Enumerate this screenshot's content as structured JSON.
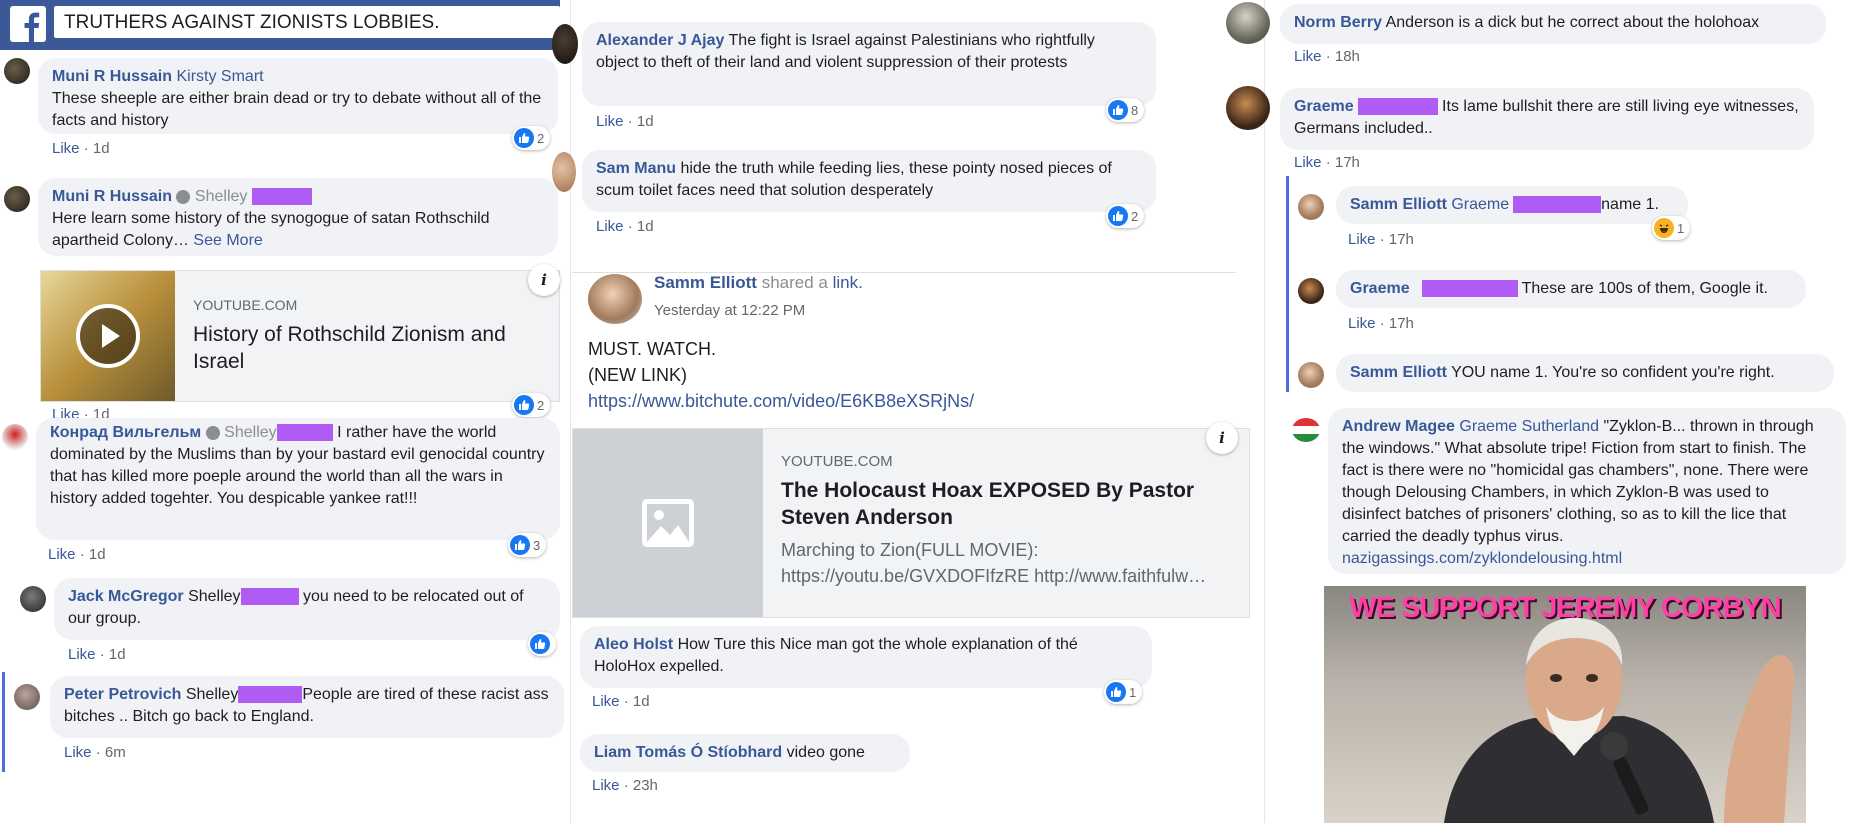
{
  "header": {
    "search_value": "TRUTHERS AGAINST ZIONISTS LOBBIES."
  },
  "colors": {
    "facebook_blue": "#3b5998",
    "link": "#385898",
    "redaction": "#b15bf5",
    "bubble": "#f0f2f5"
  },
  "left": {
    "c1": {
      "name": "Muni R Hussain",
      "mention": "Kirsty Smart",
      "text": "These sheeple are either brain dead or try to debate without all of the facts and history",
      "like": "Like",
      "time": "1d",
      "reactions": "2"
    },
    "c2": {
      "name": "Muni R Hussain",
      "mention": "Shelley",
      "text": "Here learn some history of the synogogue of satan Rothschild apartheid Colony…",
      "see_more": "See More",
      "card": {
        "source": "YOUTUBE.COM",
        "title": "History of Rothschild Zionism and Israel"
      },
      "like": "Like",
      "time": "1d",
      "reactions": "2"
    },
    "c3": {
      "name": "Конрад Вильгельм",
      "mention": "Shelley",
      "text": "I rather have the world dominated by the Muslims than by your bastard evil genocidal country that has killed more poeple around the world than all the wars in history added togehter. You despicable yankee rat!!!",
      "like": "Like",
      "time": "1d",
      "reactions": "3"
    },
    "c4": {
      "name": "Jack McGregor",
      "mention": "Shelley",
      "text": "you need to be relocated out of our group.",
      "like": "Like",
      "time": "1d"
    },
    "c5": {
      "name": "Peter Petrovich",
      "mention": "Shelley",
      "text": "People are tired of these racist ass bitches .. Bitch go back to England.",
      "like": "Like",
      "time": "6m"
    }
  },
  "middle": {
    "c1": {
      "name": "Alexander J Ajay",
      "text": "The fight is Israel against Palestinians who rightfully object to theft of their land and violent suppression of their protests",
      "like": "Like",
      "time": "1d",
      "reactions": "8"
    },
    "c2": {
      "name": "Sam Manu",
      "text": "hide the truth while feeding lies, these pointy nosed pieces of scum toilet faces need that solution desperately",
      "like": "Like",
      "time": "1d",
      "reactions": "2"
    },
    "post": {
      "author": "Samm Elliott",
      "action": "shared a",
      "link_word": "link.",
      "time": "Yesterday at 12:22 PM",
      "line1": "MUST. WATCH.",
      "line2": "(NEW LINK)",
      "url": "https://www.bitchute.com/video/E6KB8eXSRjNs/",
      "card": {
        "source": "YOUTUBE.COM",
        "title": "The Holocaust Hoax EXPOSED By Pastor Steven Anderson",
        "desc": "Marching to Zion(FULL MOVIE): https://youtu.be/GVXDOFIfzRE http://www.faithfulw…"
      }
    },
    "c3": {
      "name": "Aleo Holst",
      "text": "How Ture this Nice man got the whole explanation of thé HoloHox expelled.",
      "like": "Like",
      "time": "1d",
      "reactions": "1"
    },
    "c4": {
      "name": "Liam Tomás Ó Stíobhard",
      "text": "video gone",
      "like": "Like",
      "time": "23h"
    }
  },
  "right": {
    "c1": {
      "name": "Norm Berry",
      "text": "Anderson is a dick but he correct about the holohoax",
      "like": "Like",
      "time": "18h"
    },
    "c2": {
      "name": "Graeme",
      "text": "Its lame bullshit there are still living eye witnesses, Germans included..",
      "like": "Like",
      "time": "17h"
    },
    "r1": {
      "name": "Samm Elliott",
      "mention": "Graeme",
      "text": "name 1.",
      "like": "Like",
      "time": "17h",
      "reactions": "1"
    },
    "r2": {
      "name": "Graeme",
      "text": "These are 100s of them, Google it.",
      "like": "Like",
      "time": "17h"
    },
    "r3": {
      "name": "Samm Elliott",
      "text": "YOU name 1. You're so confident you're right."
    },
    "c3": {
      "name": "Andrew Magee",
      "mention": "Graeme Sutherland",
      "text": "\"Zyklon-B... thrown in through the windows.\" What absolute tripe! Fiction from start to finish. The fact is there were no \"homicidal gas chambers\", none. There were though Delousing Chambers, in which Zyklon-B was used to disinfect batches of prisoners' clothing, so as to kill the lice that carried the deadly typhus virus.",
      "link": "nazigassings.com/zyklondelousing.html"
    },
    "image": {
      "caption": "WE SUPPORT JEREMY CORBYN"
    }
  }
}
